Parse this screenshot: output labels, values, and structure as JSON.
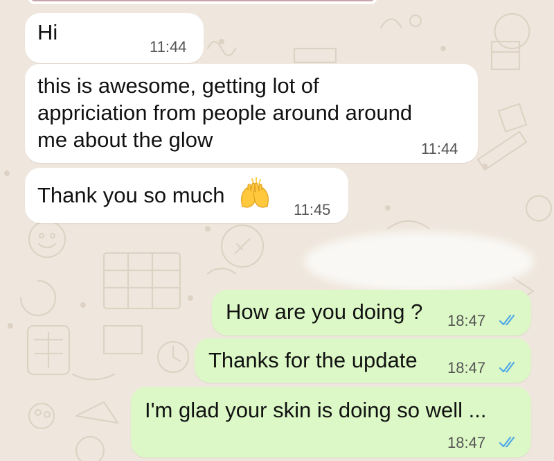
{
  "chat": {
    "messages": [
      {
        "direction": "incoming",
        "text": "Hi",
        "time": "11:44"
      },
      {
        "direction": "incoming",
        "text": "this is awesome, getting lot of\nappriciation from people around around\nme about the glow",
        "time": "11:44"
      },
      {
        "direction": "incoming",
        "text": "Thank you so much",
        "emoji": "raising-hands-icon",
        "time": "11:45"
      },
      {
        "direction": "outgoing",
        "text": "How are you doing ?",
        "time": "18:47",
        "status": "read"
      },
      {
        "direction": "outgoing",
        "text": "Thanks for the update",
        "time": "18:47",
        "status": "read"
      },
      {
        "direction": "outgoing",
        "text": "I'm glad your skin is doing so well ...",
        "time": "18:47",
        "status": "read"
      }
    ]
  },
  "colors": {
    "wallpaper": "#efe7dd",
    "incoming_bubble": "#ffffff",
    "outgoing_bubble": "#dcf8c6",
    "read_ticks": "#4fa8e8"
  }
}
